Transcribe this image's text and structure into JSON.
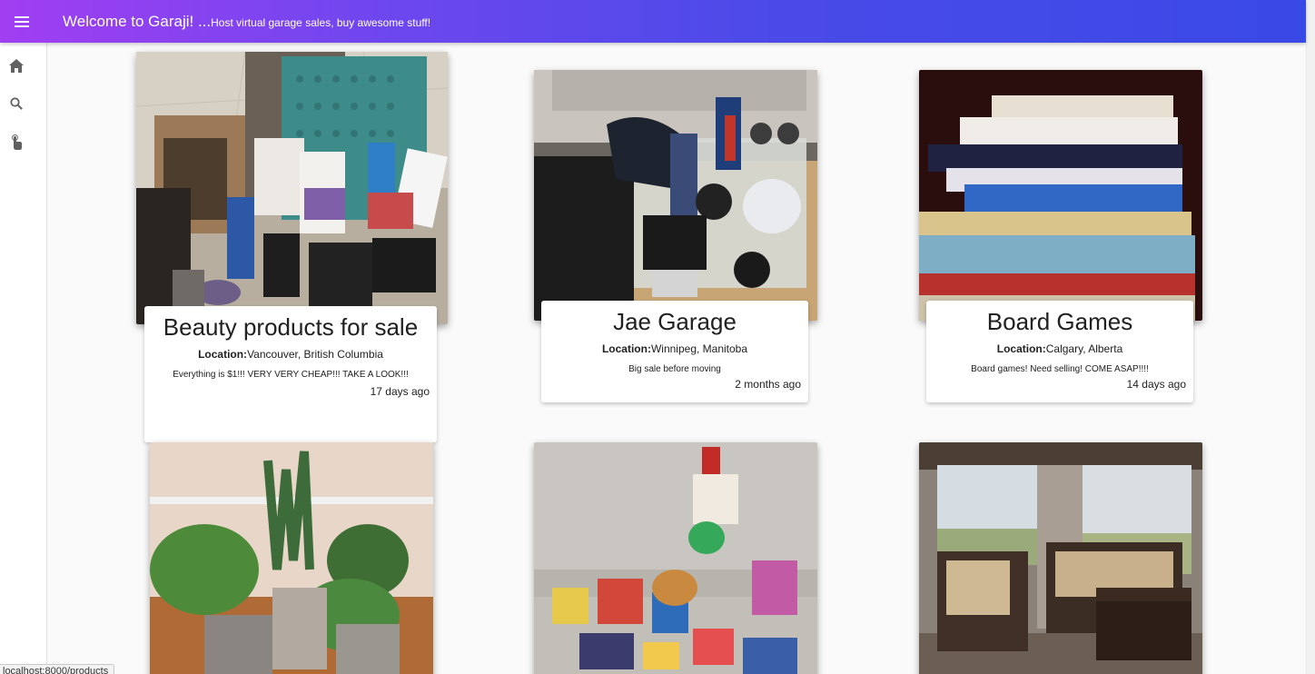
{
  "header": {
    "title": "Welcome to Garaji! ...",
    "subtitle": "Host virtual garage sales, buy awesome stuff!"
  },
  "nav": {
    "menu_icon": "menu-icon",
    "items": [
      {
        "icon": "home-icon"
      },
      {
        "icon": "search-icon"
      },
      {
        "icon": "touch-app-icon"
      }
    ]
  },
  "sales": [
    {
      "title": "Beauty products for sale",
      "location_label": "Location:",
      "location": "Vancouver, British Columbia",
      "description": "Everything is $1!!! VERY VERY CHEAP!!! TAKE A LOOK!!!",
      "posted": "17 days ago"
    },
    {
      "title": "Jae Garage",
      "location_label": "Location:",
      "location": "Winnipeg, Manitoba",
      "description": "Big sale before moving",
      "posted": "2 months ago"
    },
    {
      "title": "Board Games",
      "location_label": "Location:",
      "location": "Calgary, Alberta",
      "description": "Board games! Need selling! COME ASAP!!!!",
      "posted": "14 days ago"
    }
  ],
  "status_bar": {
    "url": "localhost:8000/products"
  },
  "colors": {
    "appbar_start": "#a13ef2",
    "appbar_end": "#3949e6"
  }
}
